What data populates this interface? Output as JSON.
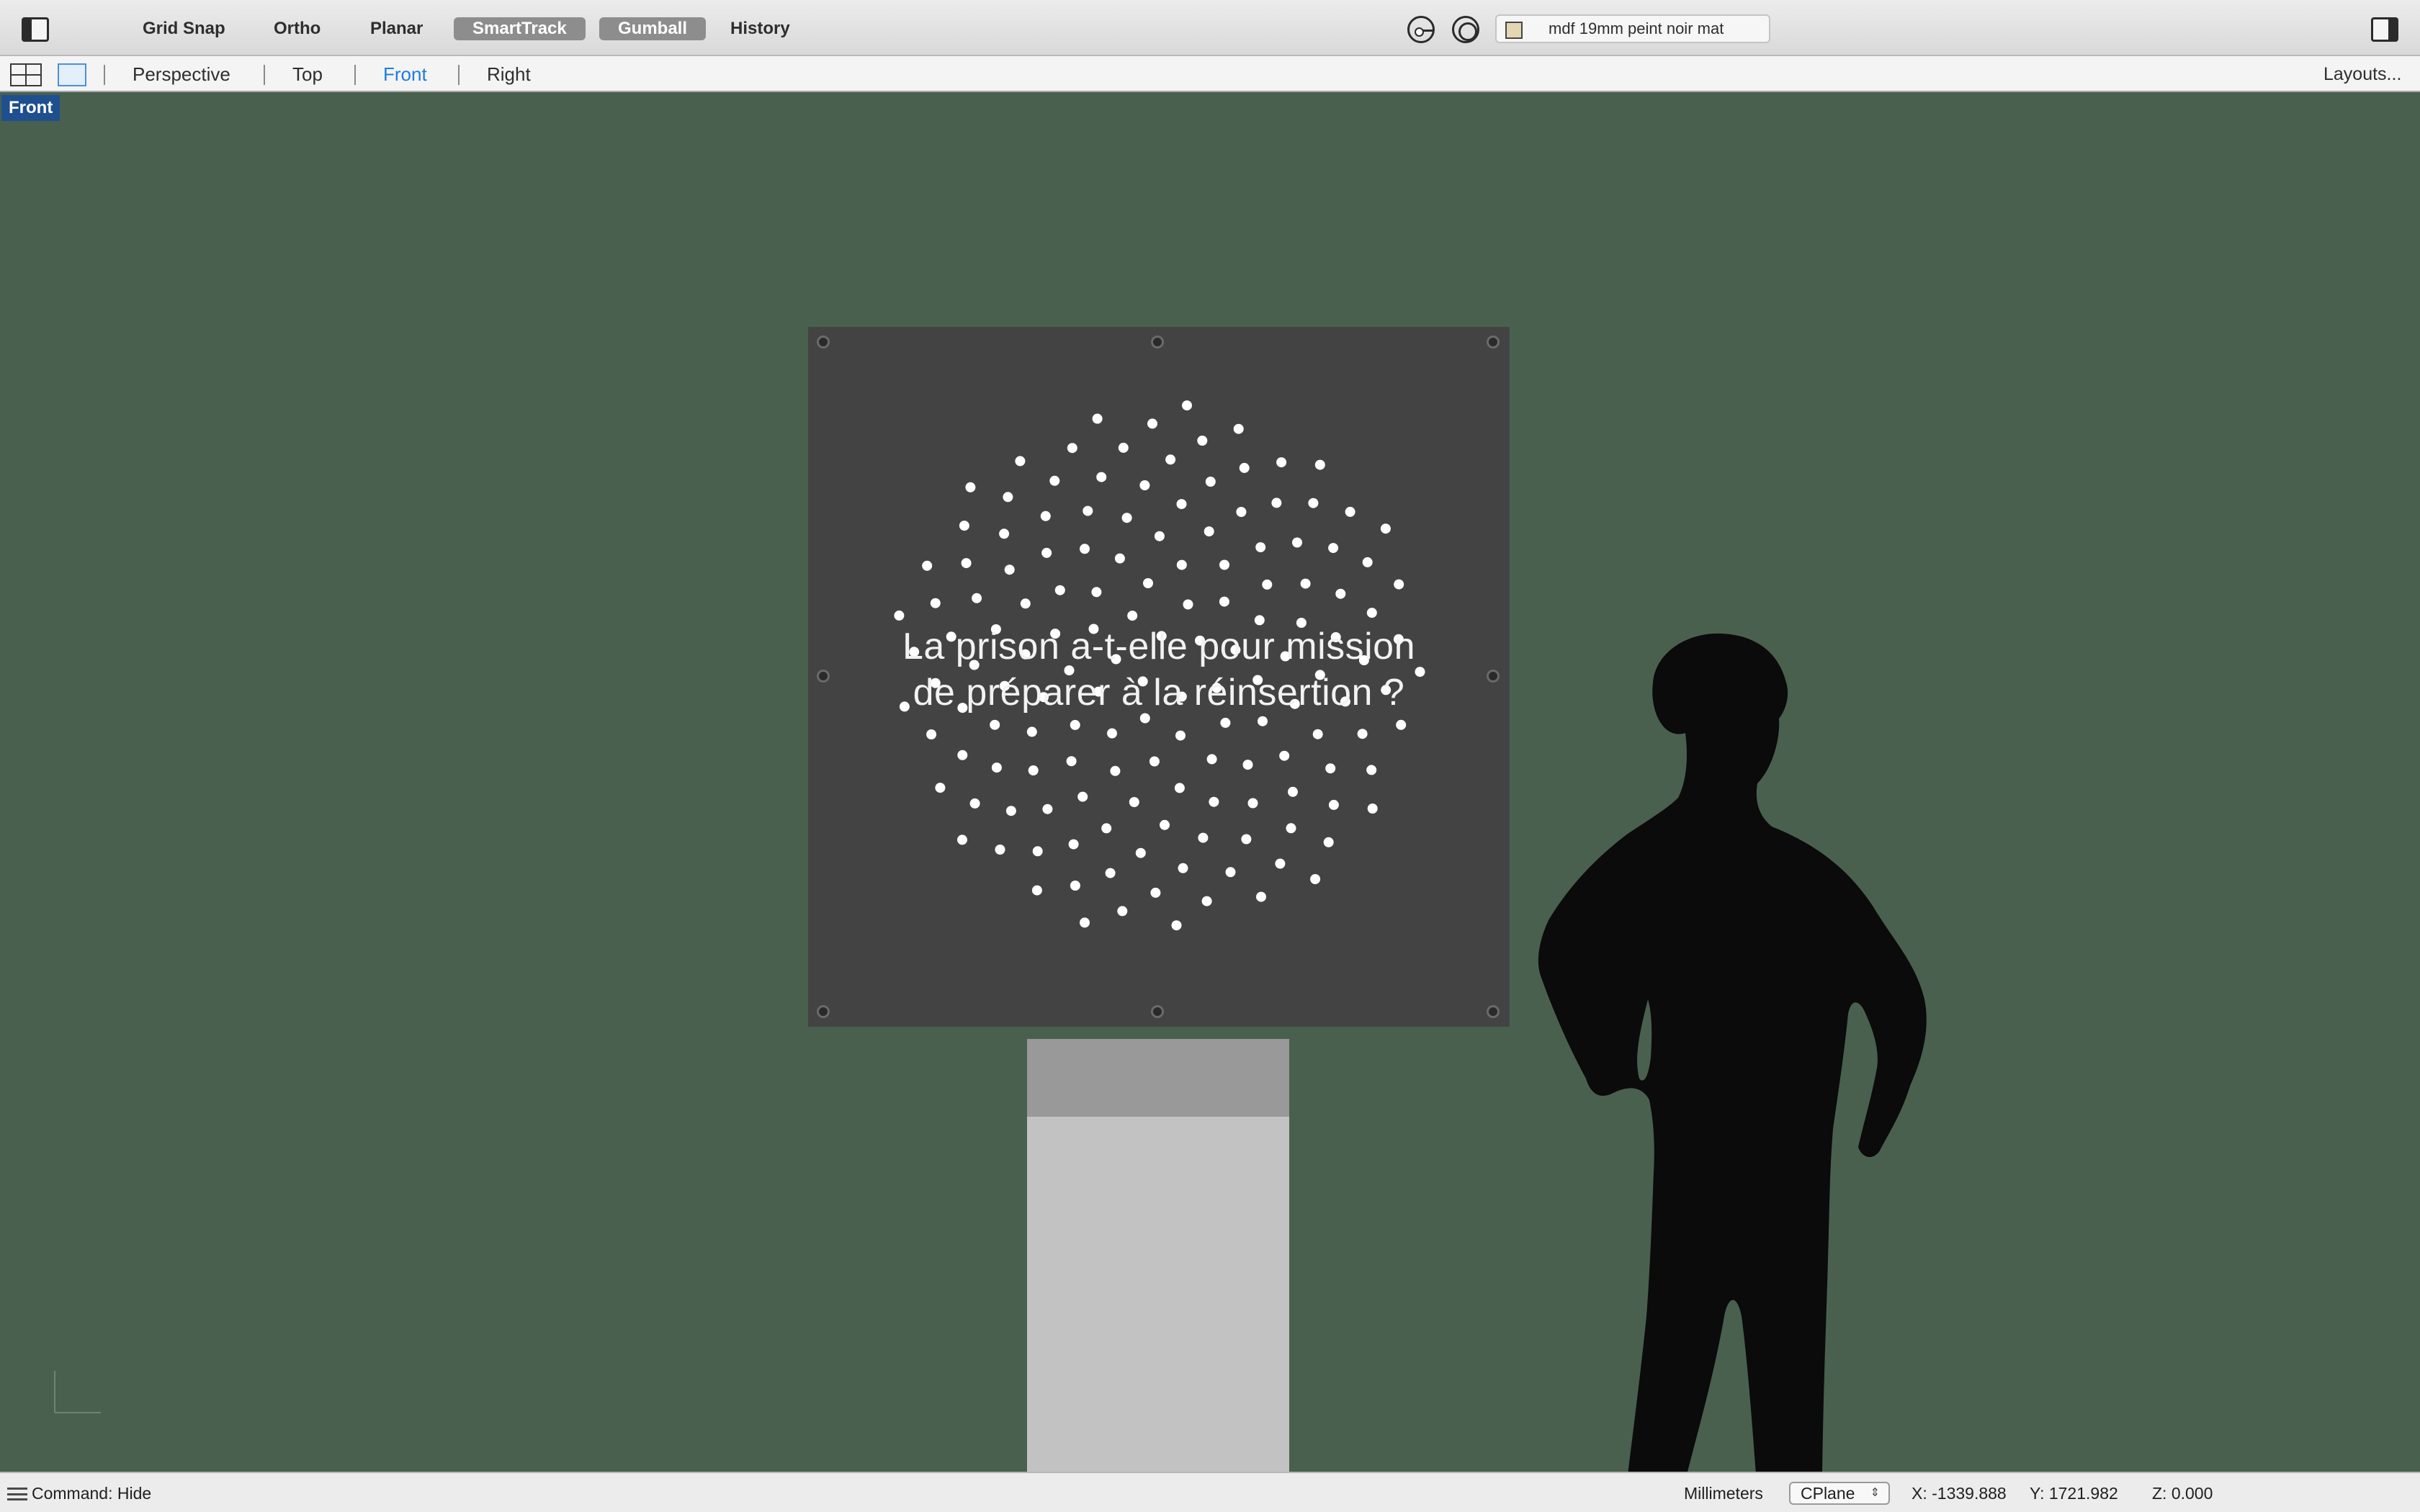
{
  "toolbar": {
    "grid_snap": "Grid Snap",
    "ortho": "Ortho",
    "planar": "Planar",
    "smarttrack": "SmartTrack",
    "gumball": "Gumball",
    "history": "History",
    "material": "mdf 19mm peint noir mat",
    "material_swatch_color": "#e4d6b3"
  },
  "viewbar": {
    "tabs": [
      "Perspective",
      "Top",
      "Front",
      "Right"
    ],
    "active_tab": "Front",
    "layouts": "Layouts..."
  },
  "viewport": {
    "label": "Front",
    "panel_title_line1": "La prison a-t-elle pour mission",
    "panel_title_line2": "de préparer à la réinsertion ?",
    "background_color": "#4a604f",
    "panel_color": "#434343",
    "dot_color": "#ffffff"
  },
  "statusbar": {
    "command": "Command: Hide",
    "units": "Millimeters",
    "cplane": "CPlane",
    "x": "X: -1339.888",
    "y": "Y: 1721.982",
    "z": "Z: 0.000"
  }
}
